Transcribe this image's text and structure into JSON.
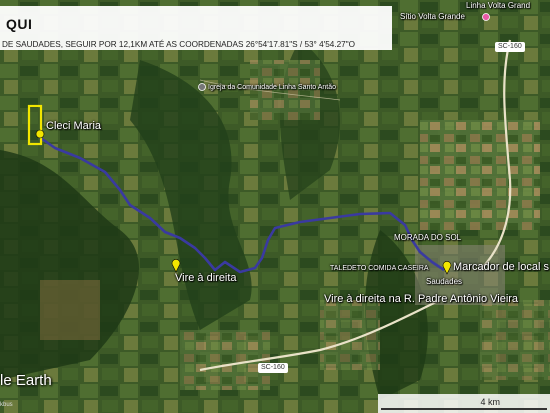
{
  "header": {
    "title": "QUI",
    "instruction": "DE SAUDADES, SEGUIR POR 12,1KM ATÉ AS COORDENADAS 26°54'17.81\"S / 53° 4'54.27\"O"
  },
  "places": {
    "top_sitio": "Sítio Volta Grande",
    "top_linha": "Linha Volta Grand",
    "church": "Igreja da Comunidade Linha Santo Antão",
    "cleci": "Cleci Maria",
    "vire_direita": "Vire à direita",
    "morada": "MORADA DO SOL",
    "taledeto": "TALEDETO COMIDA CASEIRA",
    "saudades": "Saudades",
    "marcador": "Marcador de local s",
    "vire_rua": "Vire à direita na R. Padre Antônio Vieira"
  },
  "roads": {
    "sc160_top": "SC-160",
    "sc160_bottom": "SC-160"
  },
  "branding": {
    "logo": "le Earth",
    "corner": "kbus"
  },
  "scale": {
    "label": "4 km"
  },
  "colors": {
    "route": "#3a3aa0",
    "highlight": "#f2e600",
    "road": "#e9e2c8"
  },
  "icons": [
    "map-pin-icon",
    "church-pin-icon",
    "heart-pin-icon"
  ]
}
